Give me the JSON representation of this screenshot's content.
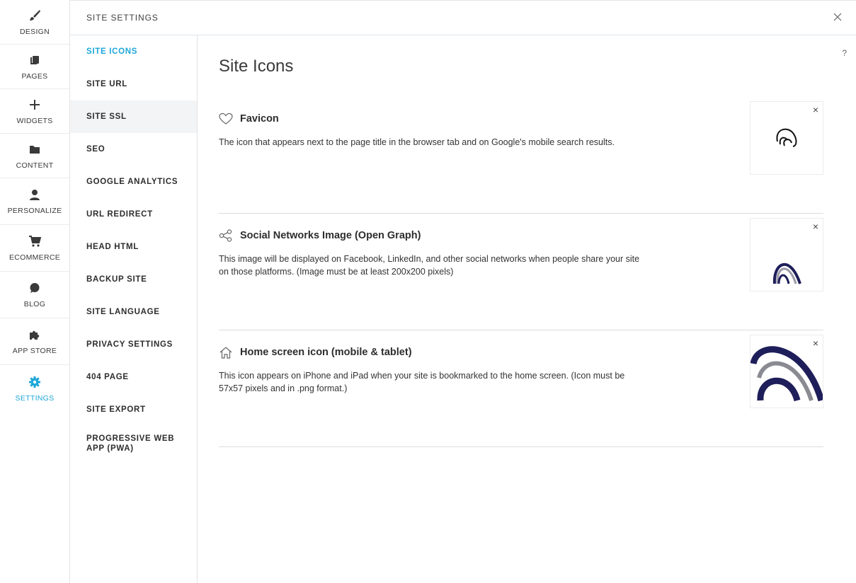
{
  "rail": {
    "items": [
      {
        "label": "DESIGN",
        "icon": "brush-icon"
      },
      {
        "label": "PAGES",
        "icon": "pages-icon"
      },
      {
        "label": "WIDGETS",
        "icon": "plus-icon"
      },
      {
        "label": "CONTENT",
        "icon": "folder-icon"
      },
      {
        "label": "PERSONALIZE",
        "icon": "person-icon"
      },
      {
        "label": "ECOMMERCE",
        "icon": "cart-icon"
      },
      {
        "label": "BLOG",
        "icon": "chat-bubble-icon"
      },
      {
        "label": "APP STORE",
        "icon": "puzzle-icon"
      },
      {
        "label": "SETTINGS",
        "icon": "gear-icon"
      }
    ],
    "active": "SETTINGS",
    "accent": "#1ea7d8"
  },
  "header": {
    "title": "SITE SETTINGS",
    "close_icon": "close-icon"
  },
  "subnav": {
    "items": [
      {
        "label": "SITE ICONS"
      },
      {
        "label": "SITE URL"
      },
      {
        "label": "SITE SSL"
      },
      {
        "label": "SEO"
      },
      {
        "label": "GOOGLE ANALYTICS"
      },
      {
        "label": "URL REDIRECT"
      },
      {
        "label": "HEAD HTML"
      },
      {
        "label": "BACKUP SITE"
      },
      {
        "label": "SITE LANGUAGE"
      },
      {
        "label": "PRIVACY SETTINGS"
      },
      {
        "label": "404 PAGE"
      },
      {
        "label": "SITE EXPORT"
      },
      {
        "label": "PROGRESSIVE WEB APP (PWA)"
      }
    ],
    "active": "SITE ICONS",
    "hovered": "SITE SSL"
  },
  "main": {
    "help": "?",
    "title": "Site Icons",
    "sections": [
      {
        "title": "Favicon",
        "icon": "heart-icon",
        "description": "The icon that appears next to the page title in the browser tab and on Google's mobile search results.",
        "remove": "×"
      },
      {
        "title": "Social Networks Image (Open Graph)",
        "icon": "share-icon",
        "description": "This image will be displayed on Facebook, LinkedIn, and other social networks when people share your site on those platforms. (Image must be at least 200x200 pixels)",
        "remove": "×"
      },
      {
        "title": "Home screen icon (mobile & tablet)",
        "icon": "home-icon",
        "description": "This icon appears on iPhone and iPad when your site is bookmarked to the home screen. (Icon must be 57x57 pixels and in .png format.)",
        "remove": "×"
      }
    ]
  }
}
